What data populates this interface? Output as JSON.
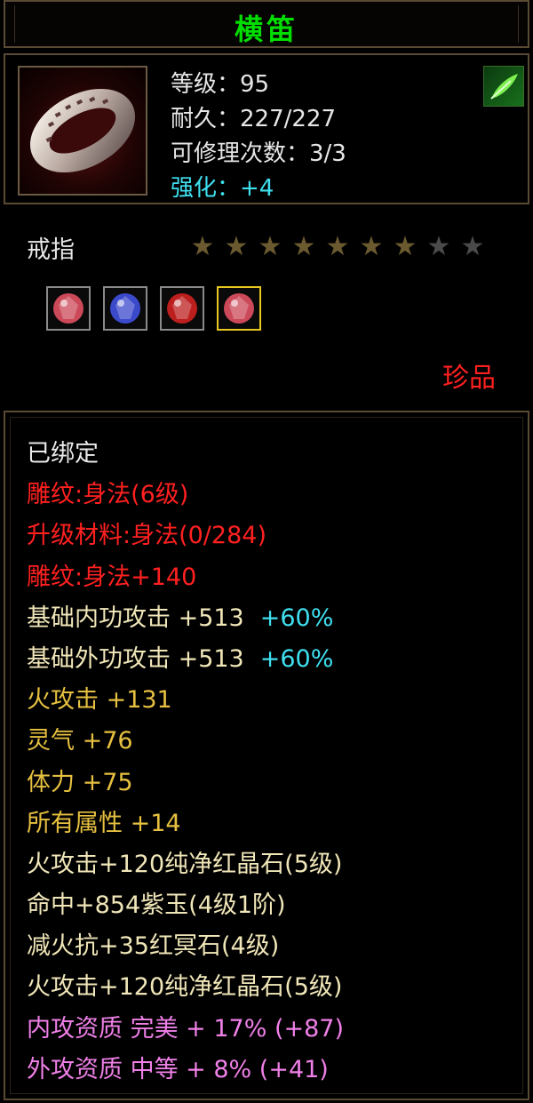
{
  "title": "横笛",
  "item": {
    "level": "等级：95",
    "durability": "耐久：227/227",
    "repairs": "可修理次数：3/3",
    "enhance": "强化：+4"
  },
  "item_type": "戒指",
  "stars": {
    "filled": 7,
    "total": 9
  },
  "gems": [
    {
      "name": "red-green-gem",
      "color": "#e05060",
      "active": false
    },
    {
      "name": "blue-gem",
      "color": "#4050e0",
      "active": false
    },
    {
      "name": "red-gem",
      "color": "#d02020",
      "active": false
    },
    {
      "name": "red-green-gem",
      "color": "#e05060",
      "active": true
    }
  ],
  "rarity": "珍品",
  "attributes": [
    {
      "text": "已绑定",
      "color": "white"
    },
    {
      "text": "雕纹:身法(6级)",
      "color": "red"
    },
    {
      "text": "升级材料:身法(0/284)",
      "color": "red"
    },
    {
      "text": "雕纹:身法+140",
      "color": "red"
    },
    {
      "text": "基础内功攻击 +513",
      "extra": "+60%",
      "color": "cream"
    },
    {
      "text": "基础外功攻击 +513",
      "extra": "+60%",
      "color": "cream"
    },
    {
      "text": "火攻击 +131",
      "color": "gold"
    },
    {
      "text": "灵气 +76",
      "color": "gold"
    },
    {
      "text": "体力 +75",
      "color": "gold"
    },
    {
      "text": "所有属性 +14",
      "color": "gold"
    },
    {
      "text": "火攻击+120纯净红晶石(5级)",
      "color": "cream"
    },
    {
      "text": "命中+854紫玉(4级1阶)",
      "color": "cream"
    },
    {
      "text": "减火抗+35红冥石(4级)",
      "color": "cream"
    },
    {
      "text": "火攻击+120纯净红晶石(5级)",
      "color": "cream"
    },
    {
      "text": "内攻资质 完美 + 17% (+87)",
      "color": "pink"
    },
    {
      "text": "外攻资质 中等 + 8% (+41)",
      "color": "pink"
    }
  ]
}
